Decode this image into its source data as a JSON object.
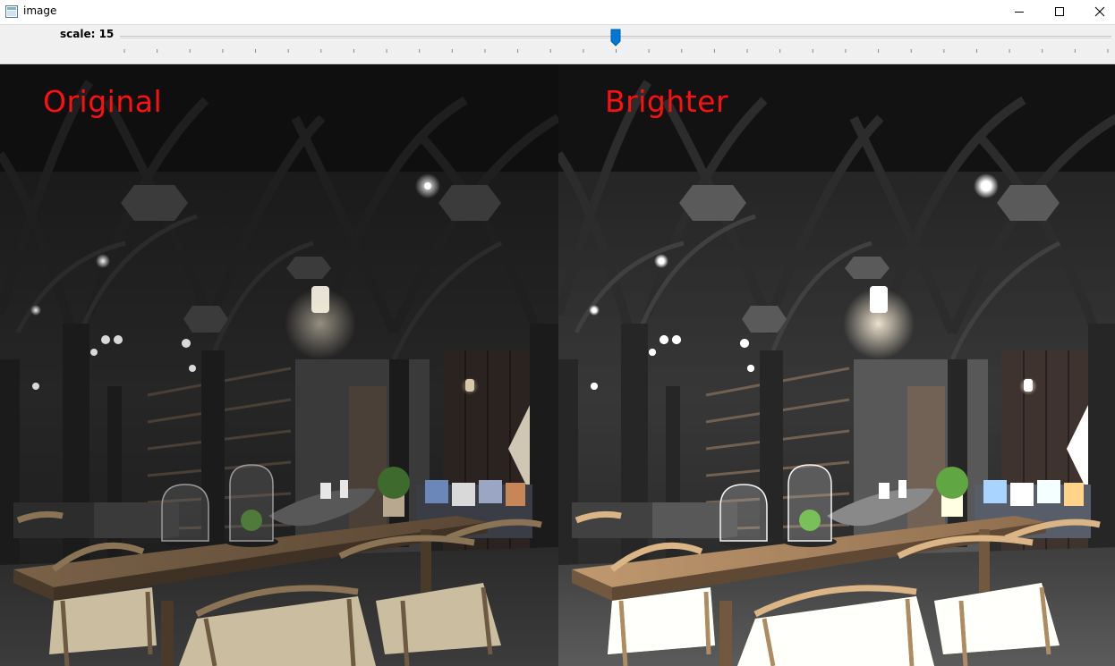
{
  "window": {
    "title": "image",
    "icon": "app-window-icon",
    "controls": [
      "minimize-icon",
      "maximize-icon",
      "close-icon"
    ]
  },
  "trackbar": {
    "label": "scale: 15",
    "value": 15,
    "position_fraction": 0.5,
    "accent": "#0078d7"
  },
  "panels": {
    "left_label": "Original",
    "right_label": "Brighter",
    "label_color": "#ff0000"
  }
}
